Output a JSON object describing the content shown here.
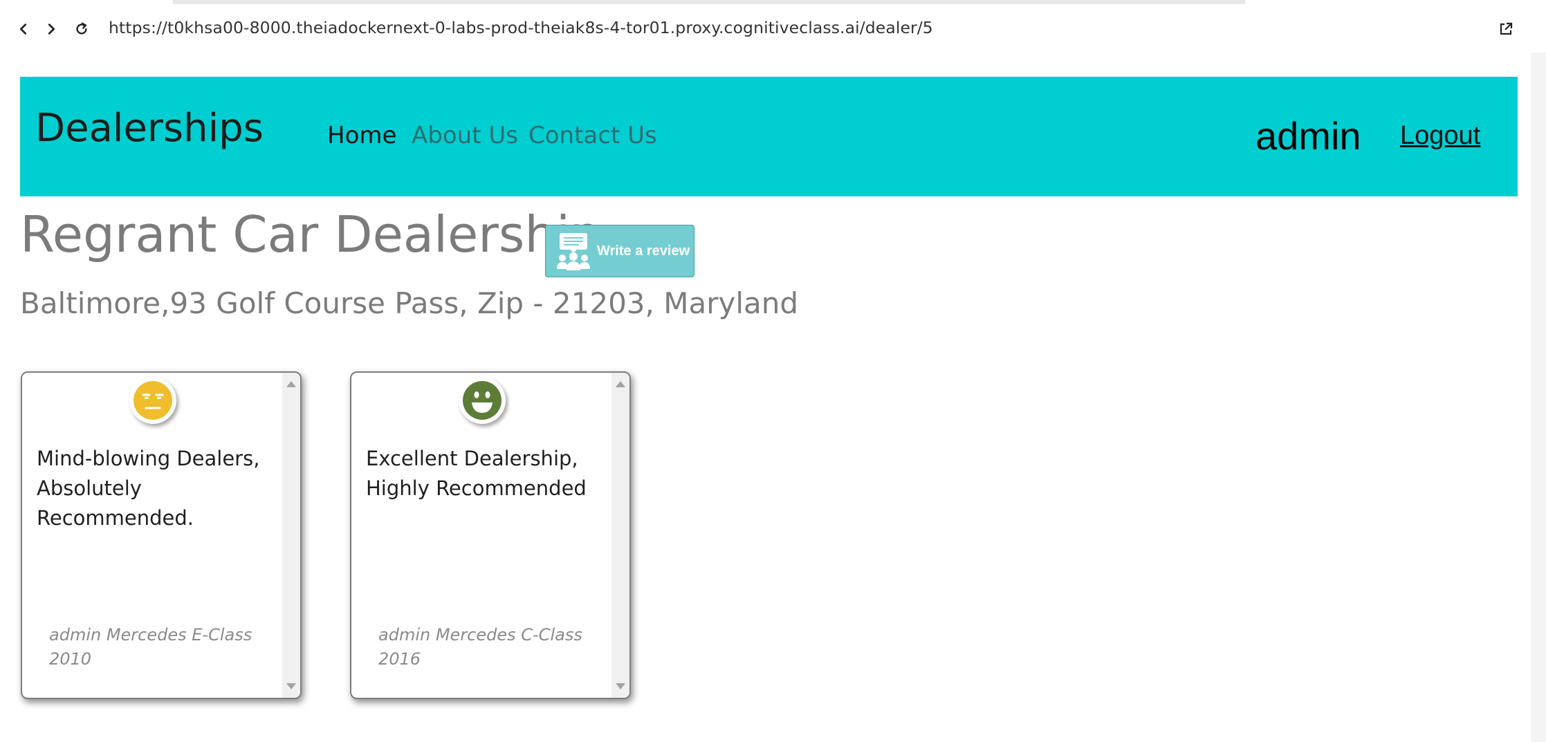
{
  "browser": {
    "url": "https://t0khsa00-8000.theiadockernext-0-labs-prod-theiak8s-4-tor01.proxy.cognitiveclass.ai/dealer/5"
  },
  "navbar": {
    "brand": "Dealerships",
    "links": [
      {
        "label": "Home",
        "active": true
      },
      {
        "label": "About Us",
        "active": false
      },
      {
        "label": "Contact Us",
        "active": false
      }
    ],
    "user": "admin",
    "logout_label": "Logout",
    "background_color": "#00ced1"
  },
  "dealer": {
    "name": "Regrant Car Dealership",
    "address": "Baltimore,93 Golf Course Pass, Zip - 21203, Maryland",
    "review_button_label": "Write a review"
  },
  "reviews": [
    {
      "sentiment": "neutral",
      "icon": "neutral-face-icon",
      "icon_color": "#f0be2d",
      "text": "Mind-blowing Dealers, Absolutely Recommended.",
      "meta": "admin Mercedes E-Class 2010"
    },
    {
      "sentiment": "positive",
      "icon": "smiling-face-icon",
      "icon_color": "#5c7c38",
      "text": "Excellent Dealership, Highly Recommended",
      "meta": "admin Mercedes C-Class 2016"
    }
  ]
}
